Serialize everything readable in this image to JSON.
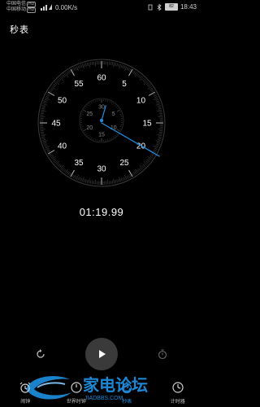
{
  "status_bar": {
    "carrier_1": "中国电信",
    "carrier_2": "中国移动",
    "hd_badge": "HD",
    "speed": "0.00K/s",
    "battery": "82",
    "time": "18:43"
  },
  "header": {
    "title": "秒表"
  },
  "dial": {
    "outer_labels": [
      "60",
      "5",
      "10",
      "15",
      "20",
      "25",
      "30",
      "35",
      "40",
      "45",
      "50",
      "55"
    ],
    "inner_labels": [
      "30",
      "5",
      "10",
      "15",
      "20",
      "25"
    ],
    "elapsed_seconds": 19.99,
    "elapsed_minutes": 1.3332,
    "accent": "#1e8fe1"
  },
  "time_display": "01:19.99",
  "controls": {
    "reset_icon": "reset-icon",
    "play_icon": "play-icon",
    "lap_icon": "lap-icon"
  },
  "nav": [
    {
      "label": "闹钟",
      "icon": "alarm-icon",
      "active": false
    },
    {
      "label": "世界时钟",
      "icon": "globe-icon",
      "active": false
    },
    {
      "label": "秒表",
      "icon": "stopwatch-icon",
      "active": true
    },
    {
      "label": "计时器",
      "icon": "timer-icon",
      "active": false
    }
  ],
  "watermark": {
    "text": "家电论坛",
    "subtext": "JIADBBS.COM"
  }
}
